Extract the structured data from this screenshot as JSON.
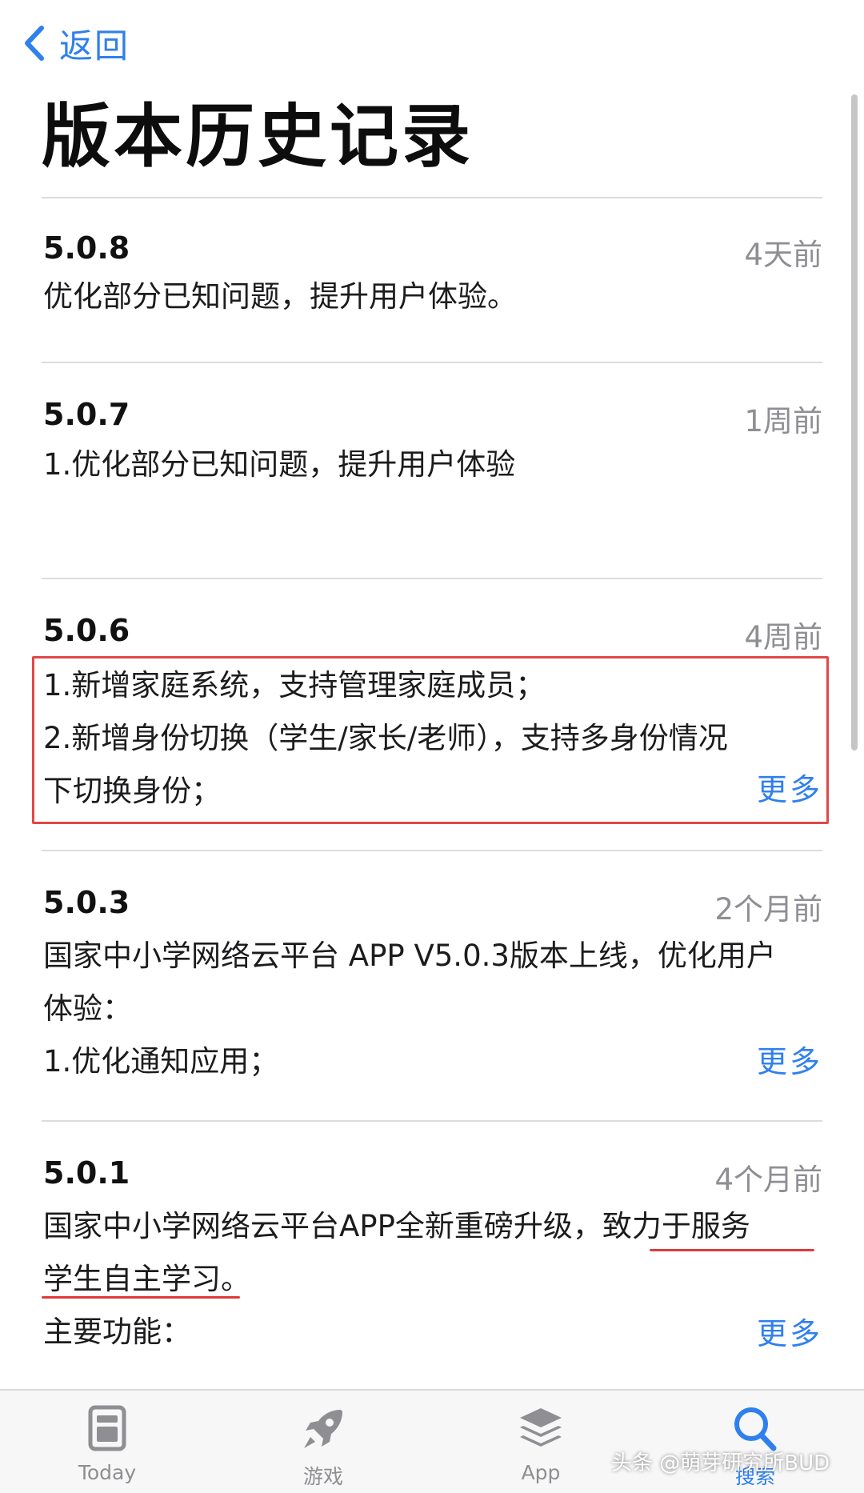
{
  "nav": {
    "back_label": "返回"
  },
  "page_title": "版本历史记录",
  "entries": [
    {
      "version": "5.0.8",
      "when": "4天前",
      "notes": "优化部分已知问题，提升用户体验。"
    },
    {
      "version": "5.0.7",
      "when": "1周前",
      "notes": "1.优化部分已知问题，提升用户体验"
    },
    {
      "version": "5.0.6",
      "when": "4周前",
      "notes": "1.新增家庭系统，支持管理家庭成员；\n2.新增身份切换（学生/家长/老师），支持多身份情况\n下切换身份；",
      "more": "更多"
    },
    {
      "version": "5.0.3",
      "when": "2个月前",
      "notes": "国家中小学网络云平台 APP V5.0.3版本上线，优化用户\n体验：\n1.优化通知应用；",
      "more": "更多"
    },
    {
      "version": "5.0.1",
      "when": "4个月前",
      "notes": "国家中小学网络云平台APP全新重磅升级，致力于服务\n学生自主学习。\n主要功能：",
      "more": "更多"
    }
  ],
  "tab_bar": {
    "items": [
      {
        "label": "Today",
        "icon": "today-icon",
        "active": false
      },
      {
        "label": "游戏",
        "icon": "rocket-icon",
        "active": false
      },
      {
        "label": "App",
        "icon": "layers-icon",
        "active": false
      },
      {
        "label": "搜索",
        "icon": "search-icon",
        "active": true
      }
    ]
  },
  "watermark": "头条 @萌芽研究所BUD",
  "colors": {
    "accent": "#2f80ed",
    "highlight": "#e04848",
    "secondary_text": "#8e8e93"
  }
}
